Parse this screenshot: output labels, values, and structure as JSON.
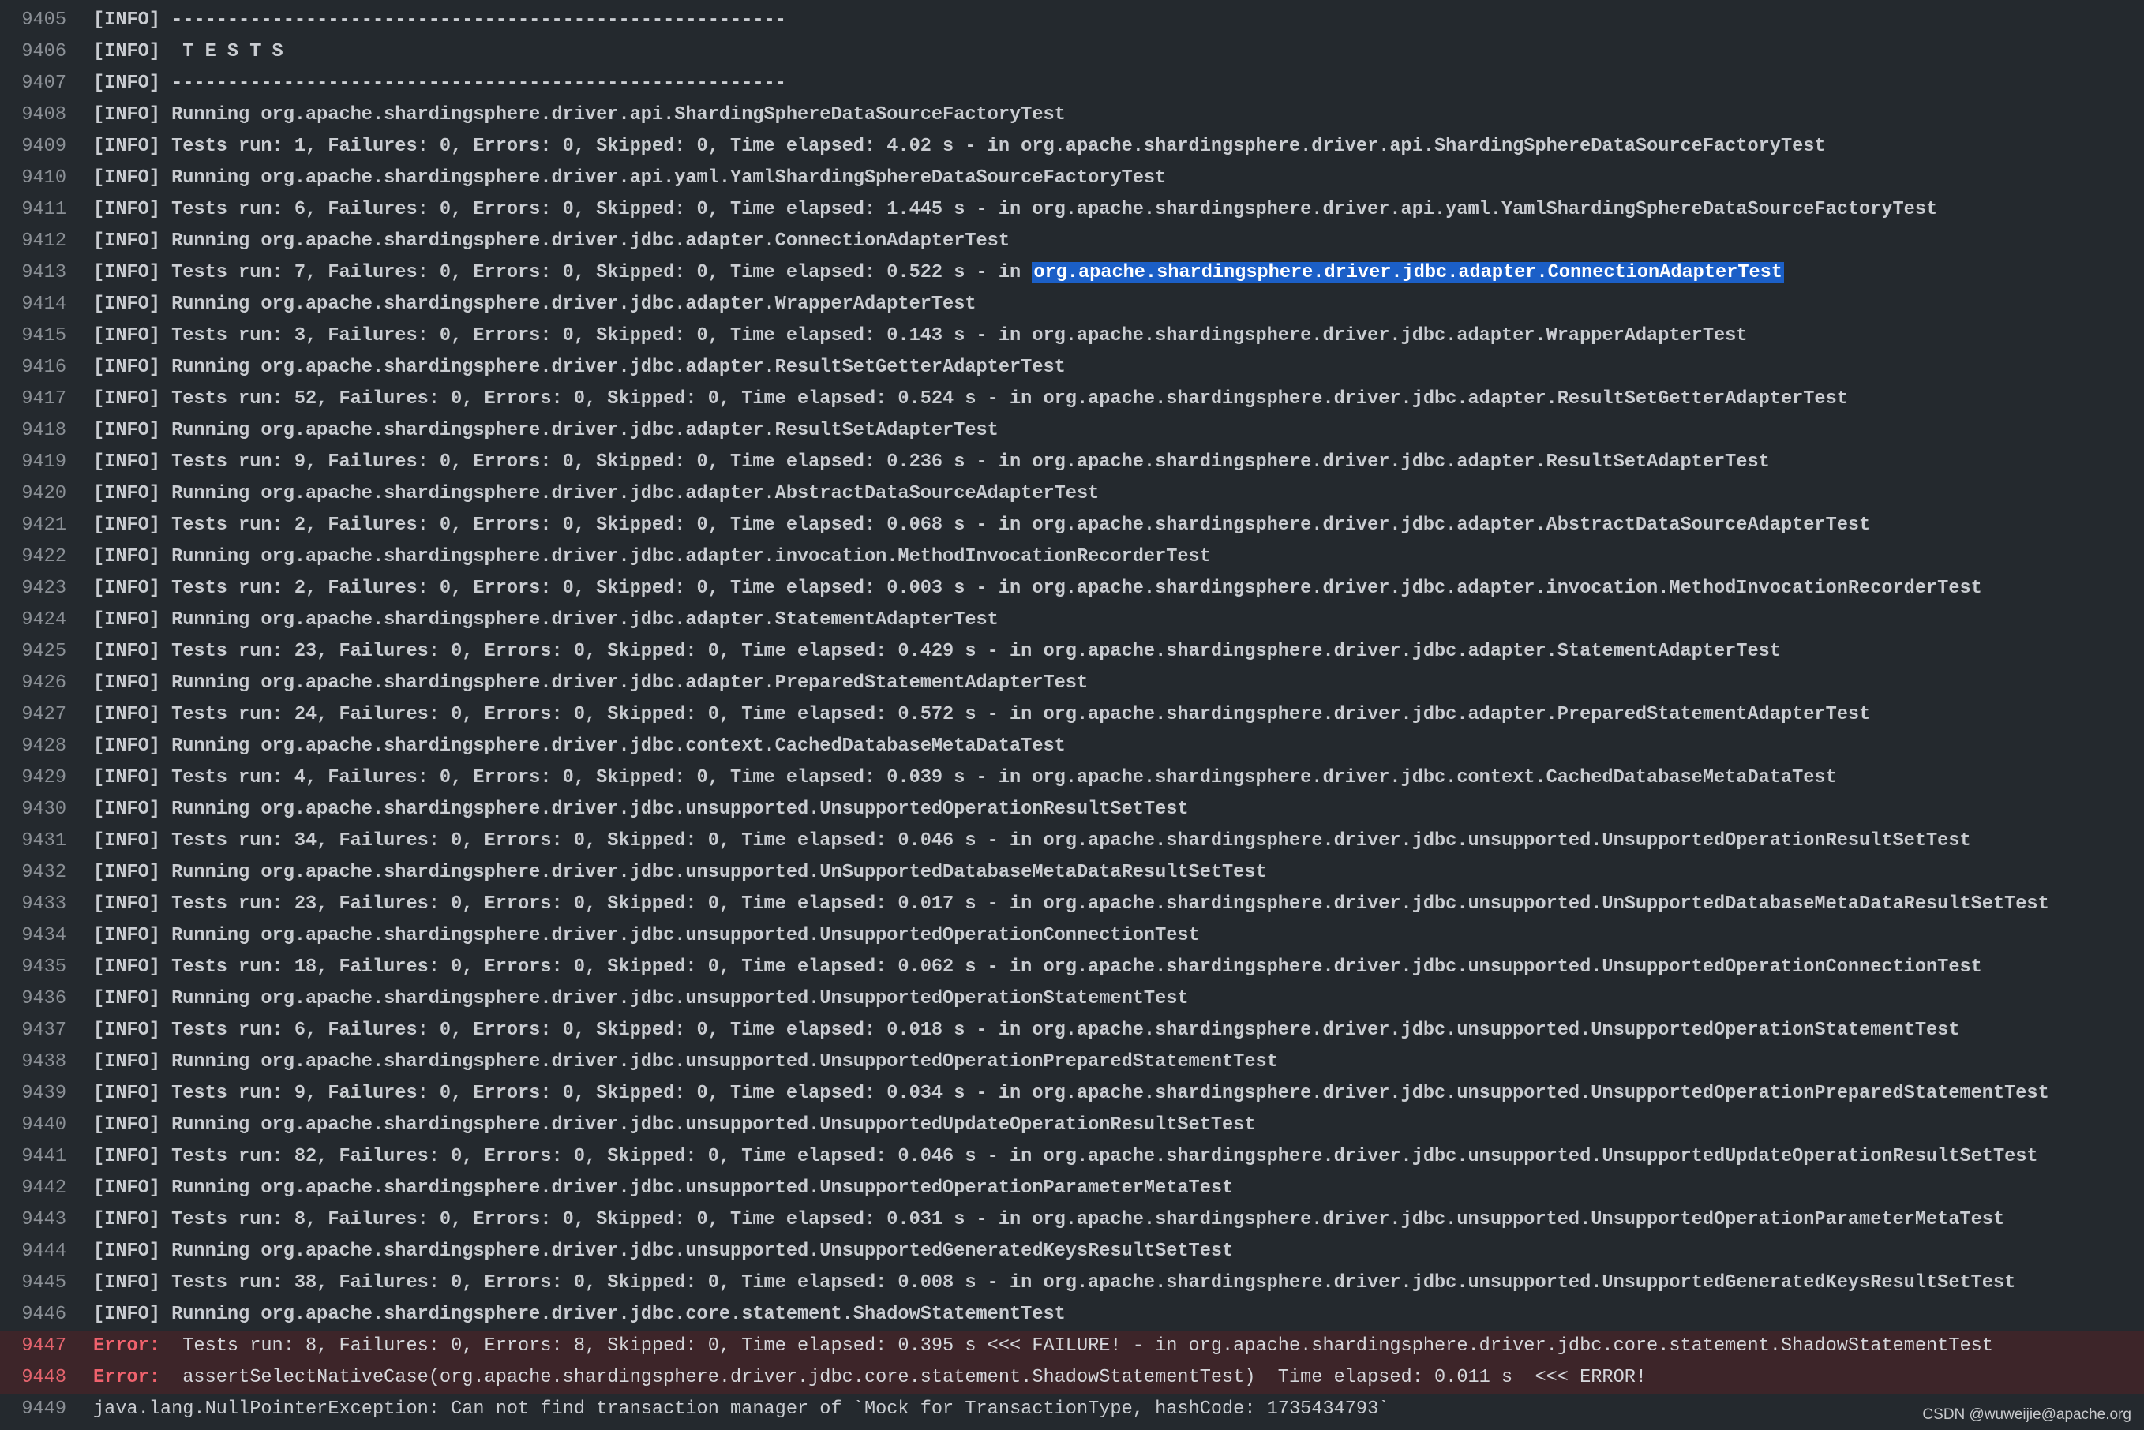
{
  "watermark": "CSDN @wuweijie@apache.org",
  "colors": {
    "background": "#24292e",
    "text": "#c9ccd1",
    "line_number": "#8b9096",
    "highlight": "#1b5fc7",
    "error": "#f0626d",
    "error_row": "#3d2529"
  },
  "lines": [
    {
      "num": "9405",
      "text": "[INFO] -------------------------------------------------------"
    },
    {
      "num": "9406",
      "text": "[INFO]  T E S T S"
    },
    {
      "num": "9407",
      "text": "[INFO] -------------------------------------------------------"
    },
    {
      "num": "9408",
      "text": "[INFO] Running org.apache.shardingsphere.driver.api.ShardingSphereDataSourceFactoryTest"
    },
    {
      "num": "9409",
      "text": "[INFO] Tests run: 1, Failures: 0, Errors: 0, Skipped: 0, Time elapsed: 4.02 s - in org.apache.shardingsphere.driver.api.ShardingSphereDataSourceFactoryTest"
    },
    {
      "num": "9410",
      "text": "[INFO] Running org.apache.shardingsphere.driver.api.yaml.YamlShardingSphereDataSourceFactoryTest"
    },
    {
      "num": "9411",
      "text": "[INFO] Tests run: 6, Failures: 0, Errors: 0, Skipped: 0, Time elapsed: 1.445 s - in org.apache.shardingsphere.driver.api.yaml.YamlShardingSphereDataSourceFactoryTest"
    },
    {
      "num": "9412",
      "text": "[INFO] Running org.apache.shardingsphere.driver.jdbc.adapter.ConnectionAdapterTest"
    },
    {
      "num": "9413",
      "text": "[INFO] Tests run: 7, Failures: 0, Errors: 0, Skipped: 0, Time elapsed: 0.522 s - in ",
      "highlight": "org.apache.shardingsphere.driver.jdbc.adapter.ConnectionAdapterTest"
    },
    {
      "num": "9414",
      "text": "[INFO] Running org.apache.shardingsphere.driver.jdbc.adapter.WrapperAdapterTest"
    },
    {
      "num": "9415",
      "text": "[INFO] Tests run: 3, Failures: 0, Errors: 0, Skipped: 0, Time elapsed: 0.143 s - in org.apache.shardingsphere.driver.jdbc.adapter.WrapperAdapterTest"
    },
    {
      "num": "9416",
      "text": "[INFO] Running org.apache.shardingsphere.driver.jdbc.adapter.ResultSetGetterAdapterTest"
    },
    {
      "num": "9417",
      "text": "[INFO] Tests run: 52, Failures: 0, Errors: 0, Skipped: 0, Time elapsed: 0.524 s - in org.apache.shardingsphere.driver.jdbc.adapter.ResultSetGetterAdapterTest"
    },
    {
      "num": "9418",
      "text": "[INFO] Running org.apache.shardingsphere.driver.jdbc.adapter.ResultSetAdapterTest"
    },
    {
      "num": "9419",
      "text": "[INFO] Tests run: 9, Failures: 0, Errors: 0, Skipped: 0, Time elapsed: 0.236 s - in org.apache.shardingsphere.driver.jdbc.adapter.ResultSetAdapterTest"
    },
    {
      "num": "9420",
      "text": "[INFO] Running org.apache.shardingsphere.driver.jdbc.adapter.AbstractDataSourceAdapterTest"
    },
    {
      "num": "9421",
      "text": "[INFO] Tests run: 2, Failures: 0, Errors: 0, Skipped: 0, Time elapsed: 0.068 s - in org.apache.shardingsphere.driver.jdbc.adapter.AbstractDataSourceAdapterTest"
    },
    {
      "num": "9422",
      "text": "[INFO] Running org.apache.shardingsphere.driver.jdbc.adapter.invocation.MethodInvocationRecorderTest"
    },
    {
      "num": "9423",
      "text": "[INFO] Tests run: 2, Failures: 0, Errors: 0, Skipped: 0, Time elapsed: 0.003 s - in org.apache.shardingsphere.driver.jdbc.adapter.invocation.MethodInvocationRecorderTest"
    },
    {
      "num": "9424",
      "text": "[INFO] Running org.apache.shardingsphere.driver.jdbc.adapter.StatementAdapterTest"
    },
    {
      "num": "9425",
      "text": "[INFO] Tests run: 23, Failures: 0, Errors: 0, Skipped: 0, Time elapsed: 0.429 s - in org.apache.shardingsphere.driver.jdbc.adapter.StatementAdapterTest"
    },
    {
      "num": "9426",
      "text": "[INFO] Running org.apache.shardingsphere.driver.jdbc.adapter.PreparedStatementAdapterTest"
    },
    {
      "num": "9427",
      "text": "[INFO] Tests run: 24, Failures: 0, Errors: 0, Skipped: 0, Time elapsed: 0.572 s - in org.apache.shardingsphere.driver.jdbc.adapter.PreparedStatementAdapterTest"
    },
    {
      "num": "9428",
      "text": "[INFO] Running org.apache.shardingsphere.driver.jdbc.context.CachedDatabaseMetaDataTest"
    },
    {
      "num": "9429",
      "text": "[INFO] Tests run: 4, Failures: 0, Errors: 0, Skipped: 0, Time elapsed: 0.039 s - in org.apache.shardingsphere.driver.jdbc.context.CachedDatabaseMetaDataTest"
    },
    {
      "num": "9430",
      "text": "[INFO] Running org.apache.shardingsphere.driver.jdbc.unsupported.UnsupportedOperationResultSetTest"
    },
    {
      "num": "9431",
      "text": "[INFO] Tests run: 34, Failures: 0, Errors: 0, Skipped: 0, Time elapsed: 0.046 s - in org.apache.shardingsphere.driver.jdbc.unsupported.UnsupportedOperationResultSetTest"
    },
    {
      "num": "9432",
      "text": "[INFO] Running org.apache.shardingsphere.driver.jdbc.unsupported.UnSupportedDatabaseMetaDataResultSetTest"
    },
    {
      "num": "9433",
      "text": "[INFO] Tests run: 23, Failures: 0, Errors: 0, Skipped: 0, Time elapsed: 0.017 s - in org.apache.shardingsphere.driver.jdbc.unsupported.UnSupportedDatabaseMetaDataResultSetTest"
    },
    {
      "num": "9434",
      "text": "[INFO] Running org.apache.shardingsphere.driver.jdbc.unsupported.UnsupportedOperationConnectionTest"
    },
    {
      "num": "9435",
      "text": "[INFO] Tests run: 18, Failures: 0, Errors: 0, Skipped: 0, Time elapsed: 0.062 s - in org.apache.shardingsphere.driver.jdbc.unsupported.UnsupportedOperationConnectionTest"
    },
    {
      "num": "9436",
      "text": "[INFO] Running org.apache.shardingsphere.driver.jdbc.unsupported.UnsupportedOperationStatementTest"
    },
    {
      "num": "9437",
      "text": "[INFO] Tests run: 6, Failures: 0, Errors: 0, Skipped: 0, Time elapsed: 0.018 s - in org.apache.shardingsphere.driver.jdbc.unsupported.UnsupportedOperationStatementTest"
    },
    {
      "num": "9438",
      "text": "[INFO] Running org.apache.shardingsphere.driver.jdbc.unsupported.UnsupportedOperationPreparedStatementTest"
    },
    {
      "num": "9439",
      "text": "[INFO] Tests run: 9, Failures: 0, Errors: 0, Skipped: 0, Time elapsed: 0.034 s - in org.apache.shardingsphere.driver.jdbc.unsupported.UnsupportedOperationPreparedStatementTest"
    },
    {
      "num": "9440",
      "text": "[INFO] Running org.apache.shardingsphere.driver.jdbc.unsupported.UnsupportedUpdateOperationResultSetTest"
    },
    {
      "num": "9441",
      "text": "[INFO] Tests run: 82, Failures: 0, Errors: 0, Skipped: 0, Time elapsed: 0.046 s - in org.apache.shardingsphere.driver.jdbc.unsupported.UnsupportedUpdateOperationResultSetTest"
    },
    {
      "num": "9442",
      "text": "[INFO] Running org.apache.shardingsphere.driver.jdbc.unsupported.UnsupportedOperationParameterMetaTest"
    },
    {
      "num": "9443",
      "text": "[INFO] Tests run: 8, Failures: 0, Errors: 0, Skipped: 0, Time elapsed: 0.031 s - in org.apache.shardingsphere.driver.jdbc.unsupported.UnsupportedOperationParameterMetaTest"
    },
    {
      "num": "9444",
      "text": "[INFO] Running org.apache.shardingsphere.driver.jdbc.unsupported.UnsupportedGeneratedKeysResultSetTest"
    },
    {
      "num": "9445",
      "text": "[INFO] Tests run: 38, Failures: 0, Errors: 0, Skipped: 0, Time elapsed: 0.008 s - in org.apache.shardingsphere.driver.jdbc.unsupported.UnsupportedGeneratedKeysResultSetTest"
    },
    {
      "num": "9446",
      "text": "[INFO] Running org.apache.shardingsphere.driver.jdbc.core.statement.ShadowStatementTest"
    },
    {
      "num": "9447",
      "error": "Error:",
      "text": "  Tests run: 8, Failures: 0, Errors: 8, Skipped: 0, Time elapsed: 0.395 s <<< FAILURE! - in org.apache.shardingsphere.driver.jdbc.core.statement.ShadowStatementTest"
    },
    {
      "num": "9448",
      "error": "Error:",
      "text": "  assertSelectNativeCase(org.apache.shardingsphere.driver.jdbc.core.statement.ShadowStatementTest)  Time elapsed: 0.011 s  <<< ERROR!"
    },
    {
      "num": "9449",
      "plain": true,
      "text": "java.lang.NullPointerException: Can not find transaction manager of `Mock for TransactionType, hashCode: 1735434793`"
    }
  ]
}
